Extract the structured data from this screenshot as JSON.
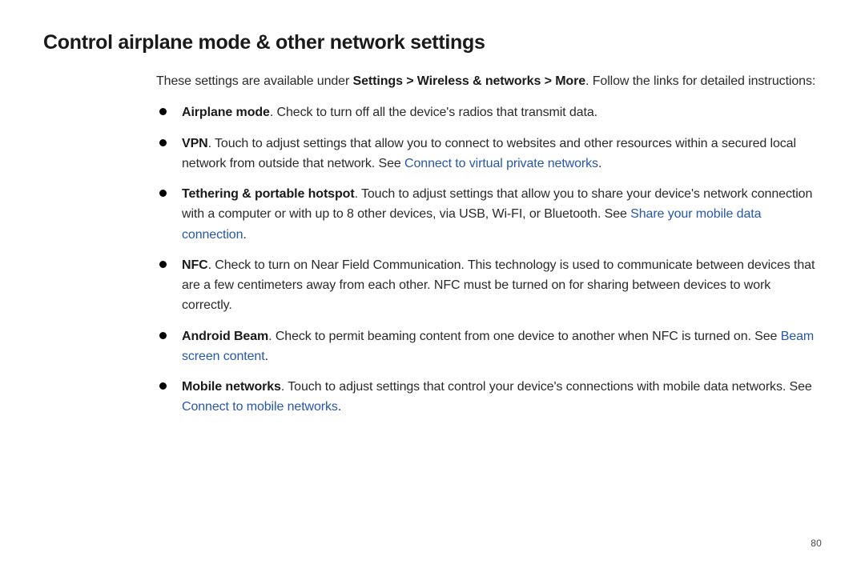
{
  "title": "Control airplane mode & other network settings",
  "intro": {
    "pre": "These settings are available under ",
    "path": "Settings > Wireless & networks > More",
    "post": ". Follow the links for detailed instructions:"
  },
  "items": [
    {
      "term": "Airplane mode",
      "text_before": ". Check to turn off all the device's radios that transmit data.",
      "link": "",
      "text_after": ""
    },
    {
      "term": "VPN",
      "text_before": ". Touch to adjust settings that allow you to connect to websites and other resources within a secured local network from outside that network. See ",
      "link": "Connect to virtual private networks",
      "text_after": "."
    },
    {
      "term": "Tethering & portable hotspot",
      "text_before": ". Touch to adjust settings that allow you to share your device's network connection with a computer or with up to 8 other devices, via USB, Wi-FI, or Bluetooth. See ",
      "link": "Share your mobile data connection",
      "text_after": "."
    },
    {
      "term": "NFC",
      "text_before": ". Check to turn on Near Field Communication. This technology is used to communicate between devices that are a few centimeters away from each other. NFC must be turned on for sharing between devices to work correctly.",
      "link": "",
      "text_after": ""
    },
    {
      "term": "Android Beam",
      "text_before": ". Check to permit beaming content from one device to another when NFC is turned on. See ",
      "link": "Beam screen content",
      "text_after": "."
    },
    {
      "term": "Mobile networks",
      "text_before": ". Touch to adjust settings that control your device's connections with mobile data networks. See ",
      "link": "Connect to mobile networks",
      "text_after": "."
    }
  ],
  "page_number": "80",
  "link_color": "#2857a5"
}
